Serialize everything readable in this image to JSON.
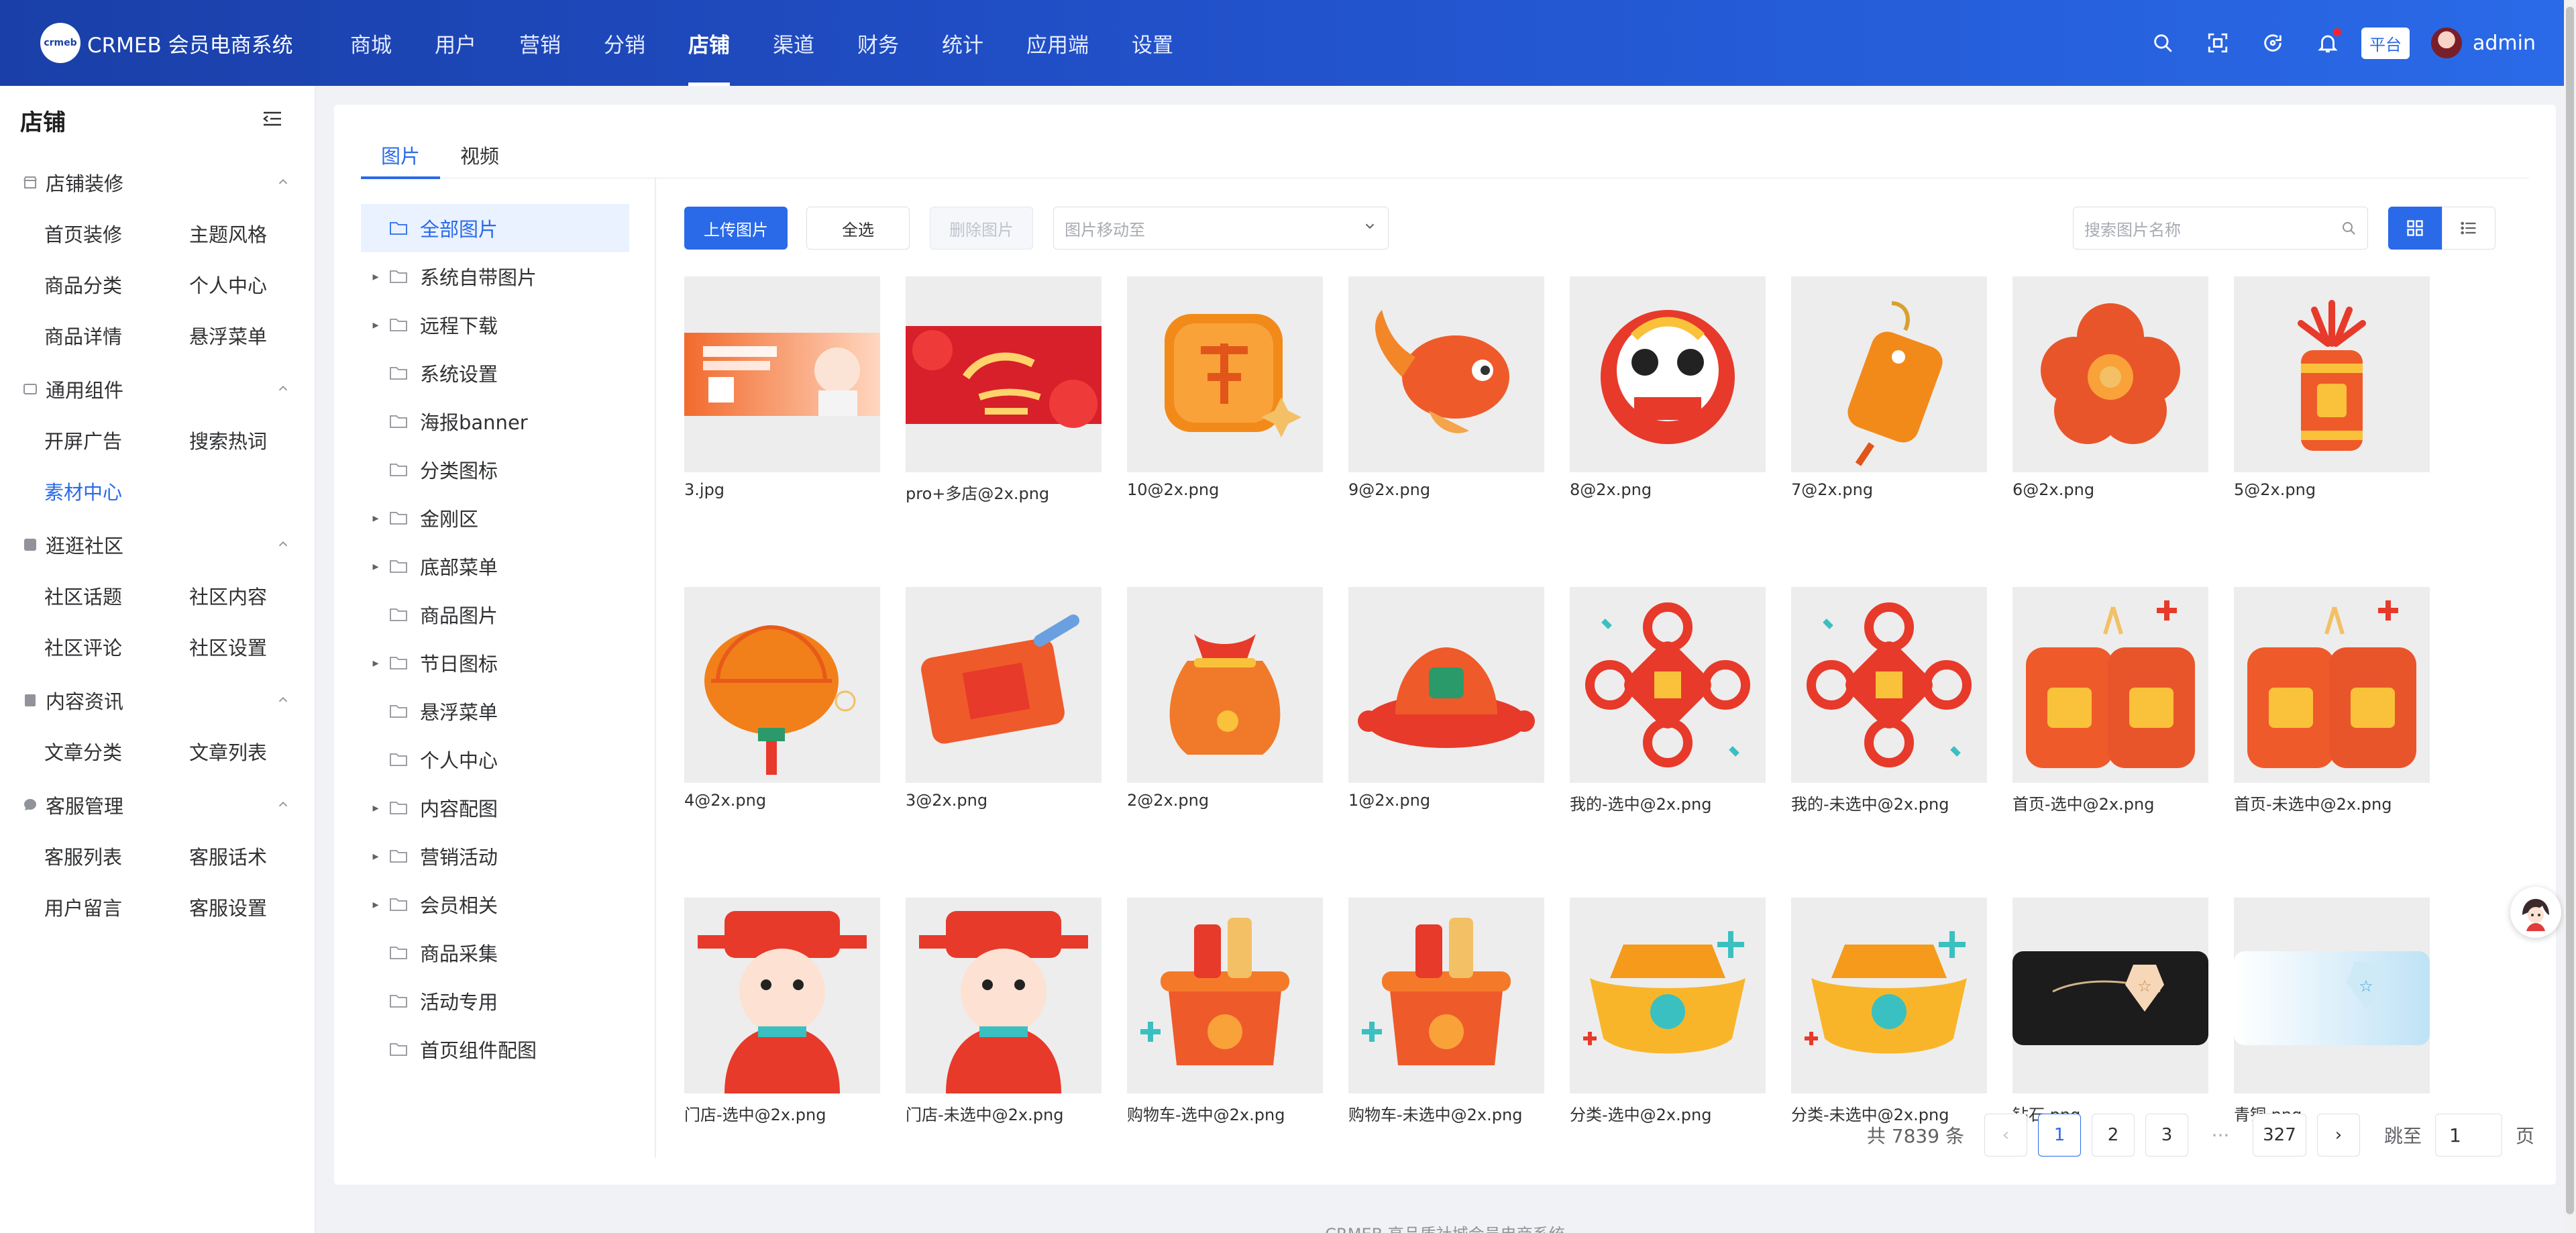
{
  "brand": {
    "logo_text": "crmeb",
    "name": "CRMEB 会员电商系统"
  },
  "topnav": [
    {
      "label": "商城"
    },
    {
      "label": "用户"
    },
    {
      "label": "营销"
    },
    {
      "label": "分销"
    },
    {
      "label": "店铺",
      "active": true
    },
    {
      "label": "渠道"
    },
    {
      "label": "财务"
    },
    {
      "label": "统计"
    },
    {
      "label": "应用端"
    },
    {
      "label": "设置"
    }
  ],
  "header_right": {
    "platform_tag": "平台",
    "username": "admin"
  },
  "sidebar": {
    "title": "店铺",
    "groups": [
      {
        "label": "店铺装修",
        "icon": "shop-icon",
        "items": [
          "首页装修",
          "主题风格",
          "商品分类",
          "个人中心",
          "商品详情",
          "悬浮菜单"
        ]
      },
      {
        "label": "通用组件",
        "icon": "component-icon",
        "items": [
          "开屏广告",
          "搜索热词",
          "素材中心"
        ],
        "active_item": "素材中心"
      },
      {
        "label": "逛逛社区",
        "icon": "community-icon",
        "items": [
          "社区话题",
          "社区内容",
          "社区评论",
          "社区设置"
        ]
      },
      {
        "label": "内容资讯",
        "icon": "article-icon",
        "items": [
          "文章分类",
          "文章列表"
        ]
      },
      {
        "label": "客服管理",
        "icon": "chat-icon",
        "items": [
          "客服列表",
          "客服话术",
          "用户留言",
          "客服设置"
        ]
      }
    ]
  },
  "tabs": [
    {
      "label": "图片",
      "active": true
    },
    {
      "label": "视频"
    }
  ],
  "tree": [
    {
      "label": "全部图片",
      "active": true,
      "expandable": false
    },
    {
      "label": "系统自带图片",
      "expandable": true
    },
    {
      "label": "远程下载",
      "expandable": true
    },
    {
      "label": "系统设置",
      "expandable": false
    },
    {
      "label": "海报banner",
      "expandable": false
    },
    {
      "label": "分类图标",
      "expandable": false
    },
    {
      "label": "金刚区",
      "expandable": true
    },
    {
      "label": "底部菜单",
      "expandable": true
    },
    {
      "label": "商品图片",
      "expandable": false
    },
    {
      "label": "节日图标",
      "expandable": true
    },
    {
      "label": "悬浮菜单",
      "expandable": false
    },
    {
      "label": "个人中心",
      "expandable": false
    },
    {
      "label": "内容配图",
      "expandable": true
    },
    {
      "label": "营销活动",
      "expandable": true
    },
    {
      "label": "会员相关",
      "expandable": true
    },
    {
      "label": "商品采集",
      "expandable": false
    },
    {
      "label": "活动专用",
      "expandable": false
    },
    {
      "label": "首页组件配图",
      "expandable": false
    }
  ],
  "toolbar": {
    "upload": "上传图片",
    "select_all": "全选",
    "delete": "删除图片",
    "move_placeholder": "图片移动至",
    "search_placeholder": "搜索图片名称"
  },
  "images": [
    {
      "name": "3.jpg",
      "kind": "banner-service"
    },
    {
      "name": "pro+多店@2x.png",
      "kind": "banner-spring"
    },
    {
      "name": "10@2x.png",
      "kind": "cai-tile"
    },
    {
      "name": "9@2x.png",
      "kind": "koi-fish"
    },
    {
      "name": "8@2x.png",
      "kind": "lion-head"
    },
    {
      "name": "7@2x.png",
      "kind": "tag-charm"
    },
    {
      "name": "6@2x.png",
      "kind": "plum-flower"
    },
    {
      "name": "5@2x.png",
      "kind": "firework-chun"
    },
    {
      "name": "4@2x.png",
      "kind": "lantern"
    },
    {
      "name": "3@2x.png",
      "kind": "fu-scroll"
    },
    {
      "name": "2@2x.png",
      "kind": "lucky-bag"
    },
    {
      "name": "1@2x.png",
      "kind": "red-hat"
    },
    {
      "name": "我的-选中@2x.png",
      "kind": "knot"
    },
    {
      "name": "我的-未选中@2x.png",
      "kind": "knot"
    },
    {
      "name": "首页-选中@2x.png",
      "kind": "firecracker"
    },
    {
      "name": "首页-未选中@2x.png",
      "kind": "firecracker"
    },
    {
      "name": "门店-选中@2x.png",
      "kind": "god-wealth"
    },
    {
      "name": "门店-未选中@2x.png",
      "kind": "god-wealth"
    },
    {
      "name": "购物车-选中@2x.png",
      "kind": "treasure-bowl"
    },
    {
      "name": "购物车-未选中@2x.png",
      "kind": "treasure-bowl"
    },
    {
      "name": "分类-选中@2x.png",
      "kind": "ingot"
    },
    {
      "name": "分类-未选中@2x.png",
      "kind": "ingot"
    },
    {
      "name": "钻石.png",
      "kind": "diamond-card"
    },
    {
      "name": "青铜.png",
      "kind": "bronze-card"
    }
  ],
  "pagination": {
    "total_text": "共 7839 条",
    "pages": [
      "1",
      "2",
      "3"
    ],
    "ellipsis": "···",
    "last_page": "327",
    "current": "1",
    "jump_label": "跳至",
    "jump_value": "1",
    "page_suffix": "页",
    "prev": "‹",
    "next": "›"
  },
  "footer": "CRMEB 高品质社城会员电商系统",
  "colors": {
    "primary": "#2a6ae8",
    "header_start": "#1a3fa8",
    "header_end": "#2a6ae8"
  }
}
